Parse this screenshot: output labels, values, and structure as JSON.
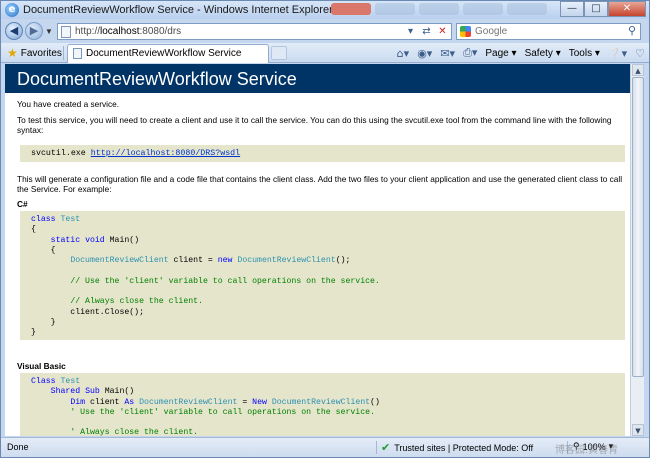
{
  "window": {
    "title": "DocumentReviewWorkflow Service - Windows Internet Explorer"
  },
  "address_bar": {
    "url_prefix": "http://",
    "url_host": "localhost",
    "url_rest": ":8080/drs"
  },
  "search": {
    "placeholder": "Google"
  },
  "toolbar": {
    "favorites_label": "Favorites",
    "tab_label": "DocumentReviewWorkflow Service",
    "page_label": "Page",
    "safety_label": "Safety",
    "tools_label": "Tools"
  },
  "page": {
    "heading": "DocumentReviewWorkflow Service",
    "intro1": "You have created a service.",
    "intro2": "To test this service, you will need to create a client and use it to call the service. You can do this using the svcutil.exe tool from the command line with the following syntax:",
    "svcutil_cmd": "svcutil.exe",
    "wsdl_link": "http://localhost:8080/DRS?wsdl",
    "para": "This will generate a configuration file and a code file that contains the client class. Add the two files to your client application and use the generated client class to call the Service. For example:",
    "csharp_label": "C#",
    "vb_label": "Visual Basic"
  },
  "status": {
    "done": "Done",
    "zone": "Trusted sites | Protected Mode: Off",
    "zoom": "100%"
  },
  "watermark": "博客园.黄春青"
}
